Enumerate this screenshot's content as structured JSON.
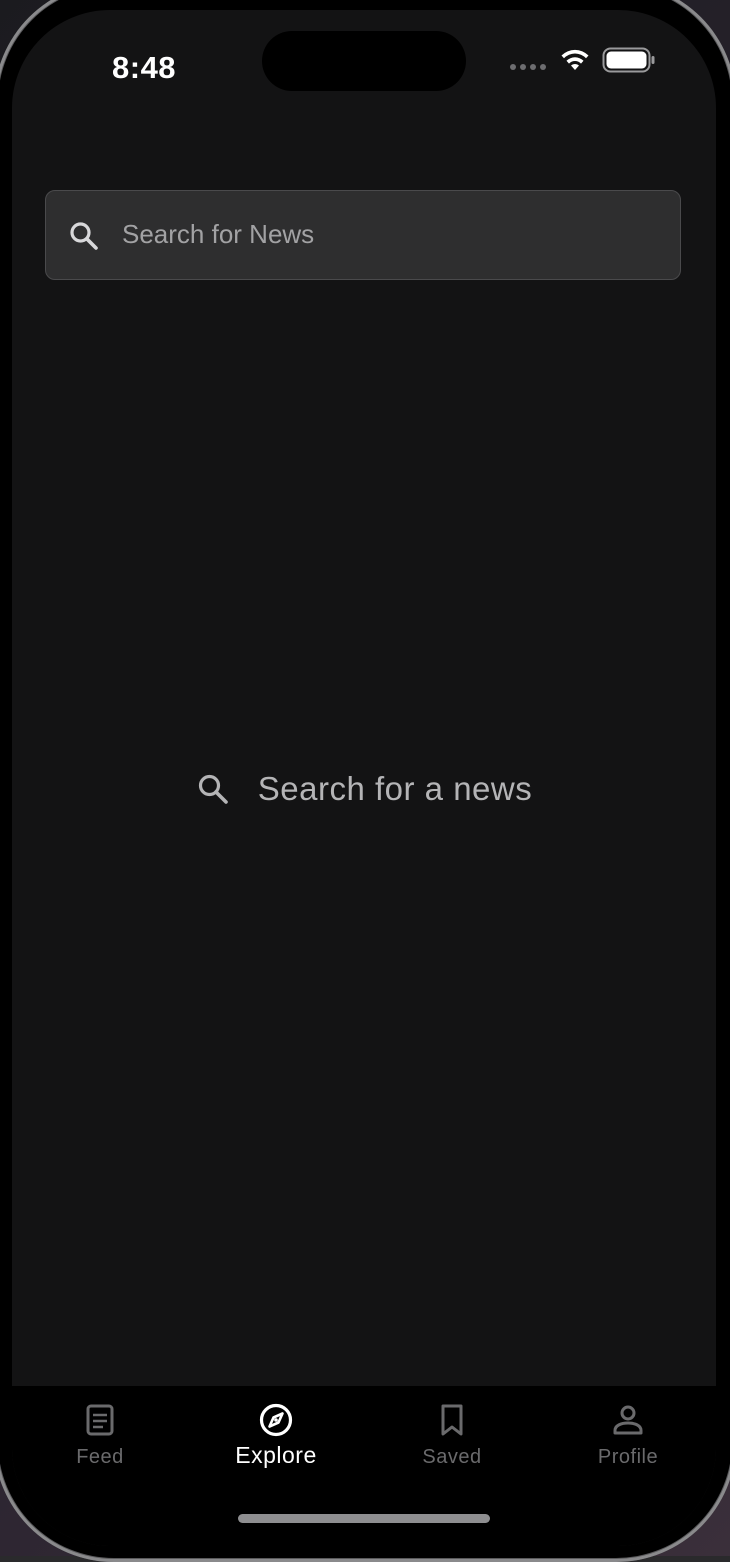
{
  "status_bar": {
    "time": "8:48"
  },
  "search": {
    "placeholder": "Search for News",
    "value": ""
  },
  "empty_state": {
    "message": "Search for a news"
  },
  "tab_bar": {
    "tabs": [
      {
        "label": "Feed",
        "icon": "document-icon",
        "active": false
      },
      {
        "label": "Explore",
        "icon": "compass-icon",
        "active": true
      },
      {
        "label": "Saved",
        "icon": "bookmark-icon",
        "active": false
      },
      {
        "label": "Profile",
        "icon": "person-icon",
        "active": false
      }
    ]
  },
  "colors": {
    "background": "#131314",
    "tab_bar_background": "#000000",
    "search_field": "#2e2e2f",
    "active_tab": "#ffffff",
    "inactive_tab": "#6a6a6c"
  }
}
